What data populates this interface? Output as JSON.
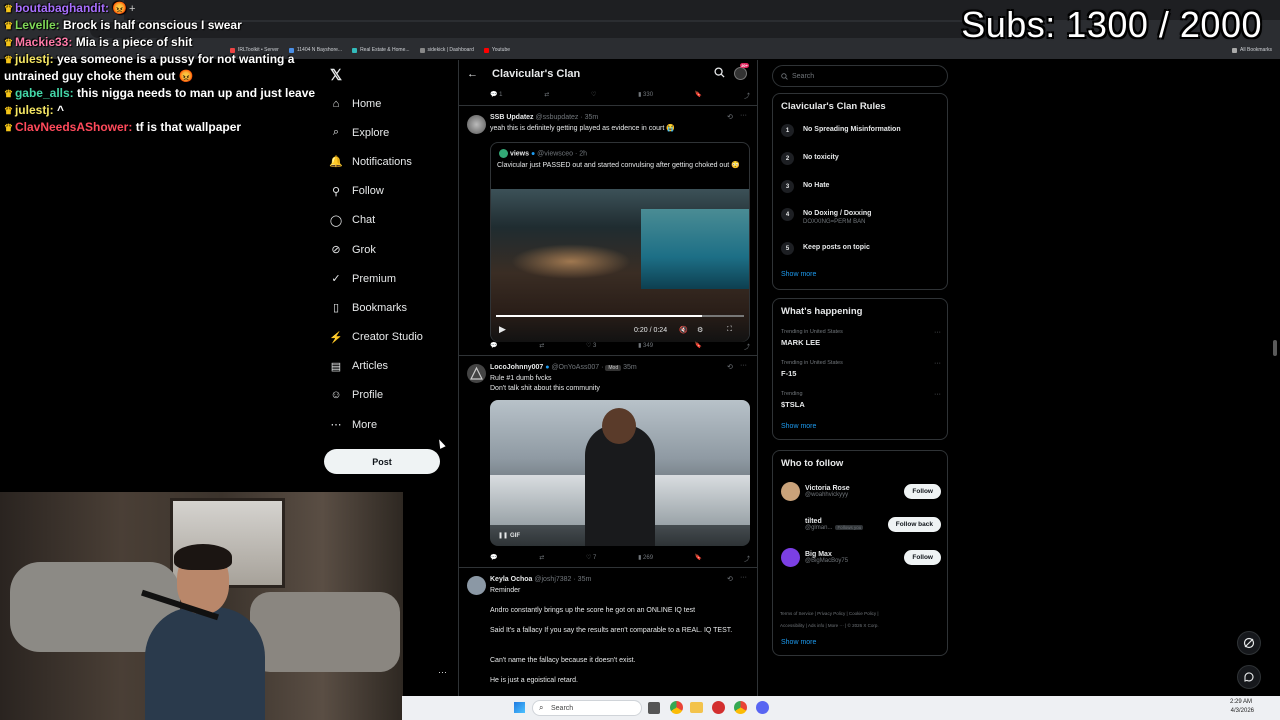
{
  "overlay": {
    "subs": "Subs: 1300 / 2000"
  },
  "chat": [
    {
      "user": "boutabaghandit:",
      "color": "#a970ff",
      "text": "",
      "emote": "angry"
    },
    {
      "user": "Levelle:",
      "color": "#7fd858",
      "text": "Brock is half conscious I swear"
    },
    {
      "user": "Mackie33:",
      "color": "#ff7aa8",
      "text": "Mia is a piece of shit"
    },
    {
      "user": "julestj:",
      "color": "#f5e663",
      "text": "yea someone is a pussy for not wanting a untrained guy choke them out",
      "emote": "angry"
    },
    {
      "user": "gabe_alls:",
      "color": "#44d7a8",
      "text": "this nigga needs to man up and just leave"
    },
    {
      "user": "julestj:",
      "color": "#f5e663",
      "text": "^"
    },
    {
      "user": "ClavNeedsAShower:",
      "color": "#ff4a5b",
      "text": "tf is that wallpaper"
    }
  ],
  "browser": {
    "bookmarks": [
      "IRLToolkit • Server",
      "11404 N Bayshore...",
      "Real Estate & Home...",
      "sidekick | Dashboard",
      "Youtube"
    ],
    "all_bookmarks": "All Bookmarks"
  },
  "nav": {
    "items": [
      {
        "label": "Home",
        "icon": "home-icon"
      },
      {
        "label": "Explore",
        "icon": "search-icon"
      },
      {
        "label": "Notifications",
        "icon": "bell-icon"
      },
      {
        "label": "Follow",
        "icon": "follow-icon"
      },
      {
        "label": "Chat",
        "icon": "chat-icon"
      },
      {
        "label": "Grok",
        "icon": "grok-icon"
      },
      {
        "label": "Premium",
        "icon": "premium-icon"
      },
      {
        "label": "Bookmarks",
        "icon": "bookmark-icon"
      },
      {
        "label": "Creator Studio",
        "icon": "creator-icon"
      },
      {
        "label": "Articles",
        "icon": "articles-icon"
      },
      {
        "label": "Profile",
        "icon": "profile-icon"
      },
      {
        "label": "More",
        "icon": "more-icon"
      }
    ],
    "post_label": "Post"
  },
  "feed": {
    "title": "Clavicular's Clan",
    "badge": "20+",
    "top_actions": {
      "replies": "1",
      "likes": "",
      "views": "330"
    },
    "tweets": [
      {
        "name": "SSB Updatez",
        "handle": "@ssbupdatez · 35m",
        "text": "yeah this is definitely getting played as evidence in court 😭",
        "quote": {
          "name": "views",
          "handle": "@viewsceo · 2h",
          "text": "Clavicular just PASSED out and started convulsing after getting choked out 😳"
        },
        "video_time": "0:20 / 0:24",
        "actions": {
          "replies": "",
          "reposts": "",
          "likes": "3",
          "views": "349"
        }
      },
      {
        "name": "LocoJohnny007",
        "handle": "@OnYoAss007 ·",
        "badge": "Mod",
        "time": "35m",
        "text1": "Rule #1 dumb fvcks",
        "text2": "Don't talk shit about this community",
        "gif_label": "GIF",
        "actions": {
          "replies": "",
          "reposts": "",
          "likes": "7",
          "views": "269"
        }
      },
      {
        "name": "Keyla Ochoa",
        "handle": "@joshj7382 · 35m",
        "lines": [
          "Reminder",
          "Andro constantly brings up the score he got on an ONLINE IQ test",
          "Said It's a fallacy If you say the results aren't comparable to a REAL. IQ TEST.",
          "Can't name the fallacy because it doesn't exist.",
          "He is just  a egoistical retard."
        ]
      }
    ]
  },
  "right": {
    "search_placeholder": "Search",
    "rules_title": "Clavicular's Clan Rules",
    "rules": [
      {
        "n": "1",
        "t": "No Spreading Misinformation",
        "s": ""
      },
      {
        "n": "2",
        "t": "No toxicity",
        "s": ""
      },
      {
        "n": "3",
        "t": "No Hate",
        "s": ""
      },
      {
        "n": "4",
        "t": "No Doxing / Doxxing",
        "s": "DOXXING=PERM BAN"
      },
      {
        "n": "5",
        "t": "Keep posts on topic",
        "s": ""
      }
    ],
    "show_more": "Show more",
    "happening_title": "What's happening",
    "trends": [
      {
        "ctx": "Trending in United States",
        "t": "MARK LEE"
      },
      {
        "ctx": "Trending in United States",
        "t": "F-15"
      },
      {
        "ctx": "Trending",
        "t": "$TSLA"
      }
    ],
    "who_title": "Who to follow",
    "who": [
      {
        "name": "Victoria Rose",
        "handle": "@woahhvickyyy",
        "btn": "Follow",
        "color": "#c9a27a"
      },
      {
        "name": "tilted",
        "handle": "@glman...",
        "extra": "Follows you",
        "btn": "Follow back",
        "color": "#000"
      },
      {
        "name": "Big Max",
        "handle": "@BigMacBoy75",
        "btn": "Follow",
        "color": "#7b3fe4"
      }
    ],
    "footer": [
      "Terms of Service",
      "Privacy Policy",
      "Cookie Policy",
      "Accessibility",
      "Ads info",
      "More ···",
      "© 2026 X Corp."
    ]
  },
  "taskbar": {
    "search": "Search",
    "time": "2:29 AM",
    "date": "4/3/2026"
  }
}
